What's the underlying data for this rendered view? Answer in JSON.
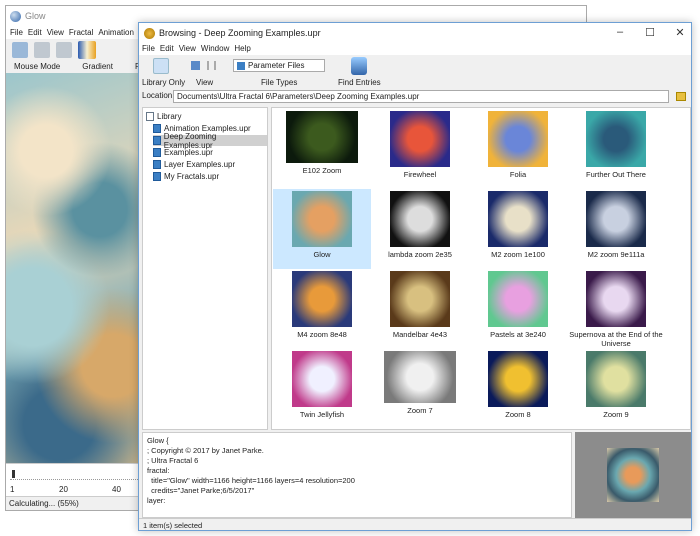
{
  "back_window": {
    "title": "Glow",
    "menu": [
      "File",
      "Edit",
      "View",
      "Fractal",
      "Animation",
      "Windo"
    ],
    "toolbar_labels": [
      "Mouse Mode",
      "Gradient",
      "R"
    ],
    "slider_ticks": [
      "1",
      "20",
      "40"
    ],
    "status": "Calculating... (55%)",
    "progress_percent": 55
  },
  "front_window": {
    "title": "Browsing - Deep Zooming Examples.upr",
    "menu": [
      "File",
      "Edit",
      "View",
      "Window",
      "Help"
    ],
    "toolbar": {
      "library_only": "Library Only",
      "view": "View",
      "file_types": "File Types",
      "file_type_value": "Parameter Files",
      "find_entries": "Find Entries"
    },
    "location_label": "Location:",
    "location_value": "Documents\\Ultra Fractal 6\\Parameters\\Deep Zooming Examples.upr",
    "tree": {
      "root": "Library",
      "items": [
        "Animation Examples.upr",
        "Deep Zooming Examples.upr",
        "Examples.upr",
        "Layer Examples.upr",
        "My Fractals.upr"
      ],
      "selected": "Deep Zooming Examples.upr"
    },
    "entries": [
      {
        "name": "E102 Zoom",
        "colors": [
          "#3c5a1e",
          "#0c1a0c"
        ]
      },
      {
        "name": "Firewheel",
        "colors": [
          "#e8553a",
          "#2a2a8a"
        ]
      },
      {
        "name": "Folia",
        "colors": [
          "#6a86d8",
          "#f0b33a"
        ]
      },
      {
        "name": "Further Out There",
        "colors": [
          "#2a5a7a",
          "#3aa8a8"
        ]
      },
      {
        "name": "Glow",
        "colors": [
          "#e5a062",
          "#6aa8b0"
        ]
      },
      {
        "name": "lambda zoom 2e35",
        "colors": [
          "#dddddd",
          "#111111"
        ]
      },
      {
        "name": "M2 zoom 1e100",
        "colors": [
          "#e8e0c8",
          "#1a2a6a"
        ]
      },
      {
        "name": "M2 zoom 9e111a",
        "colors": [
          "#c8d0e0",
          "#1a2a4a"
        ]
      },
      {
        "name": "M4 zoom 8e48",
        "colors": [
          "#e89a3a",
          "#2a3a7a"
        ]
      },
      {
        "name": "Mandelbar 4e43",
        "colors": [
          "#d8c080",
          "#5a3a1a"
        ]
      },
      {
        "name": "Pastels at 3e240",
        "colors": [
          "#e8a0e0",
          "#60c890"
        ]
      },
      {
        "name": "Supernova at the End of the Universe",
        "colors": [
          "#e8d8f0",
          "#3a1a4a"
        ]
      },
      {
        "name": "Twin Jellyfish",
        "colors": [
          "#f0f0ff",
          "#c03a8a"
        ]
      },
      {
        "name": "Zoom 7",
        "colors": [
          "#f0f0f0",
          "#7a7a7a"
        ]
      },
      {
        "name": "Zoom 8",
        "colors": [
          "#f0c030",
          "#0a1a5a"
        ]
      },
      {
        "name": "Zoom 9",
        "colors": [
          "#e0e0a0",
          "#4a7a6a"
        ]
      }
    ],
    "selected_entry": "Glow",
    "code": "Glow {\n; Copyright © 2017 by Janet Parke.\n; Ultra Fractal 6\nfractal:\n  title=\"Glow\" width=1166 height=1166 layers=4 resolution=200\n  credits=\"Janet Parke;6/5/2017\"\nlayer:",
    "status": "1 item(s) selected"
  }
}
